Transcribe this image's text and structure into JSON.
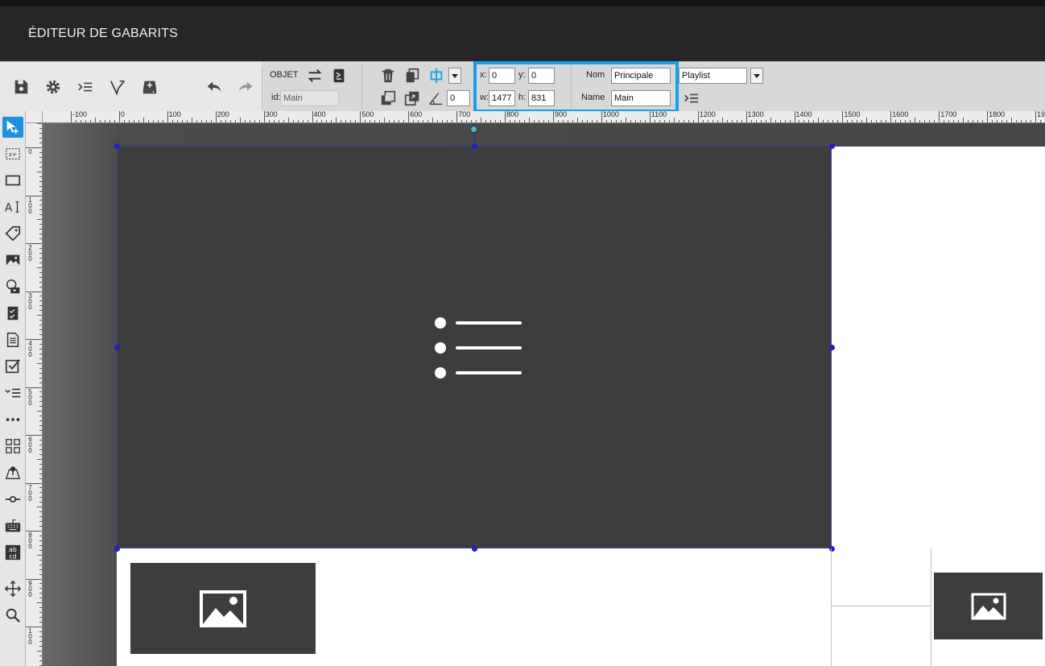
{
  "app": {
    "title": "ÉDITEUR DE GABARITS"
  },
  "toolbar": {
    "object_label": "OBJET",
    "id_label": "id:",
    "id_value": "Main",
    "angle_value": "0",
    "x_label": "x:",
    "x_value": "0",
    "y_label": "y:",
    "y_value": "0",
    "w_label": "w:",
    "w_value": "1477",
    "h_label": "h:",
    "h_value": "831",
    "nom_label": "Nom",
    "nom_value": "Principale",
    "name_label": "Name",
    "name_value": "Main",
    "type_value": "Playlist"
  },
  "ruler": {
    "h_labels": [
      "-100",
      "0",
      "100",
      "200",
      "300",
      "400",
      "500",
      "600",
      "700",
      "800",
      "900",
      "1000",
      "1100",
      "1200",
      "1300",
      "1400",
      "1500",
      "1600",
      "1700",
      "1800",
      "19"
    ],
    "v_labels": [
      "0",
      "100",
      "200",
      "300",
      "400",
      "500",
      "600",
      "700",
      "800",
      "900",
      "100"
    ]
  },
  "colors": {
    "accent": "#1a9fe6",
    "region": "#3e3d3e",
    "selection": "#1f1fd0",
    "rotate_handle": "#49c88a"
  },
  "icons": {
    "toolbar": [
      "save-icon",
      "gear-icon",
      "list-indent-icon",
      "pen-tool-icon",
      "add-drive-icon",
      "undo-icon",
      "redo-icon",
      "swap-icon",
      "template-icon",
      "trash-icon",
      "copy-icon",
      "align-center-icon",
      "send-backward-icon",
      "bring-forward-icon",
      "angle-icon",
      "list-indent-icon"
    ],
    "sidebar": [
      "select-tool-icon",
      "z-order-icon",
      "rectangle-icon",
      "text-tool-icon",
      "tag-icon",
      "image-icon",
      "media-icon",
      "checklist-icon",
      "document-icon",
      "checkbox-icon",
      "check-list-icon",
      "more-icon",
      "grid-icon",
      "map-icon",
      "slider-icon",
      "keyboard-icon",
      "abcd-icon",
      "move-icon",
      "zoom-icon"
    ]
  }
}
